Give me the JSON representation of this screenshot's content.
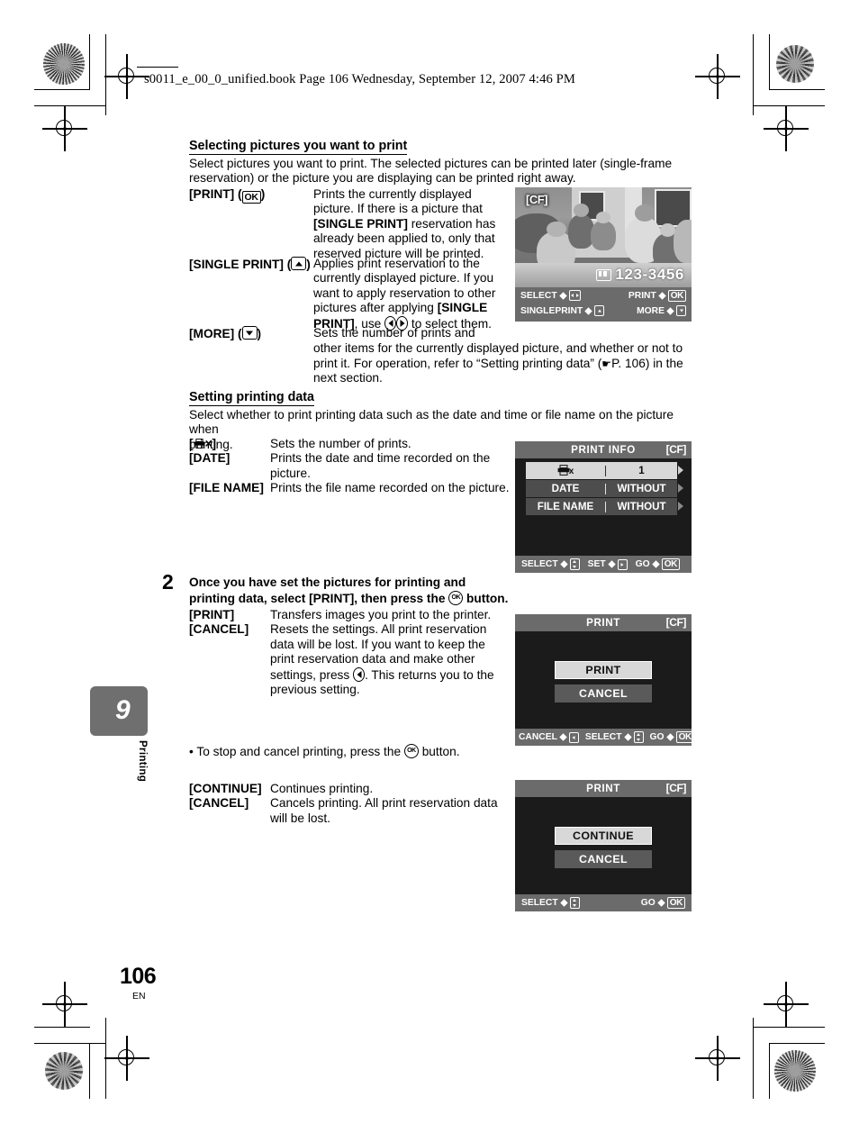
{
  "page": {
    "header": "s0011_e_00_0_unified.book  Page 106  Wednesday, September 12, 2007  4:46 PM",
    "number": "106",
    "language": "EN",
    "chapter_number": "9",
    "chapter_label": "Printing"
  },
  "section1": {
    "heading": "Selecting pictures you want to print",
    "intro_line1": "Select pictures you want to print. The selected pictures can be printed later (single-frame",
    "intro_line2": "reservation) or the picture you are displaying can be printed right away.",
    "items": [
      {
        "term": "[PRINT] (",
        "term_suffix": ")",
        "key": "OK",
        "desc_lines": [
          "Prints the currently displayed",
          "picture. If there is a picture that",
          "[SINGLE PRINT] reservation has",
          "already been applied to, only that",
          "reserved picture will be printed."
        ]
      },
      {
        "term": "[SINGLE PRINT] (",
        "term_suffix": ")",
        "key": "up-arrow",
        "desc_lines": [
          "Applies print reservation to the",
          "currently displayed picture. If you",
          "want to apply reservation to other",
          "pictures after applying [SINGLE",
          "PRINT], use  to select them."
        ]
      },
      {
        "term": "[MORE] (",
        "term_suffix": ")",
        "key": "down-arrow",
        "desc_lines": [
          "Sets the number of prints and",
          "other items for the currently displayed picture, and whether or not to",
          "print it. For operation, refer to “Setting printing data” ( P. 106) in the",
          "next section."
        ]
      }
    ]
  },
  "section2": {
    "heading": "Setting printing data",
    "intro_line1": "Select whether to print printing data such as the date and time or file name on the picture when",
    "intro_line2": "printing.",
    "items": [
      {
        "term": "[",
        "term_suffix": "×]",
        "desc": "Sets the number of prints."
      },
      {
        "term": "[DATE]",
        "desc_lines": [
          "Prints the date and time recorded on the",
          "picture."
        ]
      },
      {
        "term": "[FILE NAME]",
        "desc": "Prints the file name recorded on the picture."
      }
    ]
  },
  "step2": {
    "number": "2",
    "line1": "Once you have set the pictures for printing and",
    "line2_a": "printing data, select [PRINT], then press the ",
    "line2_b": " button.",
    "items": [
      {
        "term": "[PRINT]",
        "desc": "Transfers images you print to the printer."
      },
      {
        "term": "[CANCEL]",
        "desc_lines": [
          "Resets the settings. All print reservation",
          "data will be lost. If you want to keep the",
          "print reservation data and make other",
          "settings, press  . This returns you to the",
          "previous setting."
        ]
      }
    ],
    "bullet_a": "• To stop and cancel printing, press the ",
    "bullet_b": " button.",
    "items2": [
      {
        "term": "[CONTINUE]",
        "desc": "Continues printing."
      },
      {
        "term": "[CANCEL]",
        "desc_lines": [
          "Cancels printing. All print reservation data",
          "will be lost."
        ]
      }
    ]
  },
  "lcd_playback": {
    "cf_label": "[CF]",
    "file_number": "123-3456",
    "footer": {
      "select_label": "SELECT",
      "print_label": "PRINT",
      "print_key": "OK",
      "singleprint_label": "SINGLEPRINT",
      "more_label": "MORE"
    }
  },
  "lcd_printinfo": {
    "title": "PRINT INFO",
    "cf_label": "[CF]",
    "rows": [
      {
        "label": "printer-x-icon",
        "value": "1",
        "selected": true
      },
      {
        "label": "DATE",
        "value": "WITHOUT",
        "selected": false
      },
      {
        "label": "FILE NAME",
        "value": "WITHOUT",
        "selected": false
      }
    ],
    "footer": {
      "select_label": "SELECT",
      "set_label": "SET",
      "go_label": "GO",
      "go_key": "OK"
    }
  },
  "lcd_print": {
    "title": "PRINT",
    "cf_label": "[CF]",
    "options": [
      {
        "label": "PRINT",
        "selected": true
      },
      {
        "label": "CANCEL",
        "selected": false
      }
    ],
    "footer": {
      "cancel_label": "CANCEL",
      "select_label": "SELECT",
      "go_label": "GO",
      "go_key": "OK"
    }
  },
  "lcd_continue": {
    "title": "PRINT",
    "cf_label": "[CF]",
    "options": [
      {
        "label": "CONTINUE",
        "selected": true
      },
      {
        "label": "CANCEL",
        "selected": false
      }
    ],
    "footer": {
      "select_label": "SELECT",
      "go_label": "GO",
      "go_key": "OK"
    }
  }
}
